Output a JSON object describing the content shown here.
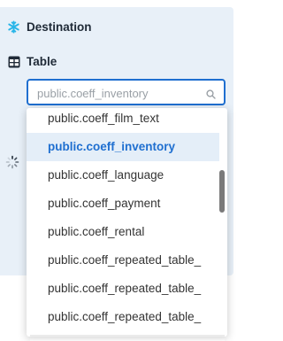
{
  "destination": {
    "icon": "snowflake-icon",
    "label": "Destination",
    "icon_color": "#29b5e8"
  },
  "table": {
    "icon": "table-icon",
    "label": "Table"
  },
  "search": {
    "placeholder": "public.coeff_inventory",
    "value": ""
  },
  "dropdown": {
    "options": [
      {
        "label": "public.coeff_film_text",
        "selected": false
      },
      {
        "label": "public.coeff_inventory",
        "selected": true
      },
      {
        "label": "public.coeff_language",
        "selected": false
      },
      {
        "label": "public.coeff_payment",
        "selected": false
      },
      {
        "label": "public.coeff_rental",
        "selected": false
      },
      {
        "label": "public.coeff_repeated_table_",
        "selected": false
      },
      {
        "label": "public.coeff_repeated_table_",
        "selected": false
      },
      {
        "label": "public.coeff_repeated_table_",
        "selected": false
      }
    ]
  },
  "colors": {
    "accent": "#1f6fd0",
    "panel_bg": "#e8f0f8",
    "selected_bg": "#e4eef8"
  }
}
